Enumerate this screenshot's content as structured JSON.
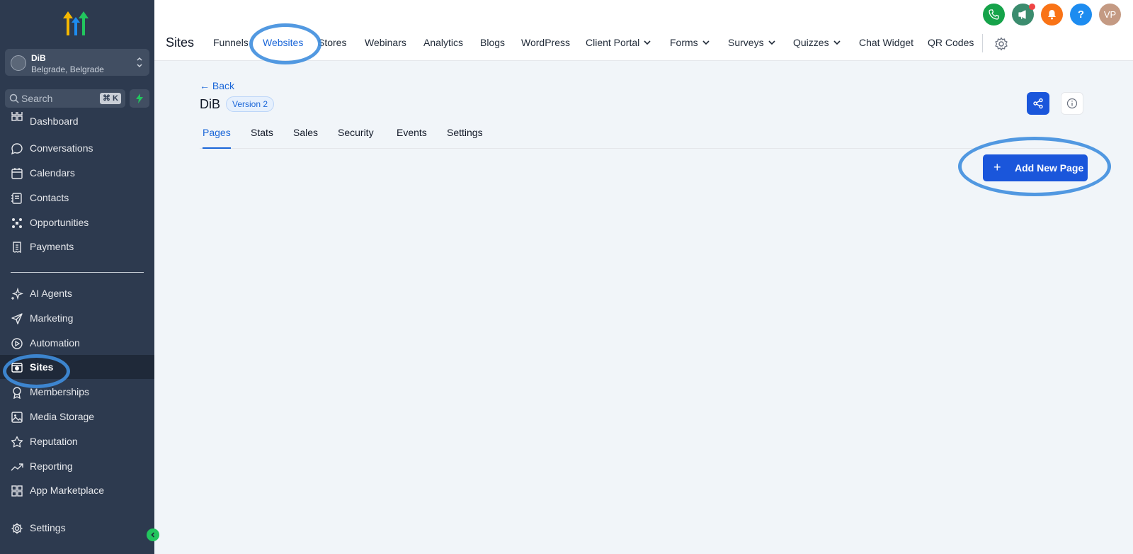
{
  "sidebar": {
    "account": {
      "name": "DiB",
      "location": "Belgrade, Belgrade"
    },
    "search": {
      "placeholder": "Search",
      "shortcut": "⌘ K"
    },
    "items": [
      {
        "label": "Dashboard",
        "icon": "dashboard-icon"
      },
      {
        "label": "Conversations",
        "icon": "chat-bubble-icon"
      },
      {
        "label": "Calendars",
        "icon": "calendar-icon"
      },
      {
        "label": "Contacts",
        "icon": "contacts-icon"
      },
      {
        "label": "Opportunities",
        "icon": "opportunities-icon"
      },
      {
        "label": "Payments",
        "icon": "payments-icon"
      },
      {
        "label": "AI Agents",
        "icon": "sparkle-icon"
      },
      {
        "label": "Marketing",
        "icon": "send-icon"
      },
      {
        "label": "Automation",
        "icon": "automation-icon"
      },
      {
        "label": "Sites",
        "icon": "sites-icon"
      },
      {
        "label": "Memberships",
        "icon": "award-icon"
      },
      {
        "label": "Media Storage",
        "icon": "image-icon"
      },
      {
        "label": "Reputation",
        "icon": "star-icon"
      },
      {
        "label": "Reporting",
        "icon": "trend-icon"
      },
      {
        "label": "App Marketplace",
        "icon": "grid-icon"
      },
      {
        "label": "Settings",
        "icon": "gear-icon"
      }
    ],
    "active_item": "Sites"
  },
  "topbar": {
    "title": "Sites",
    "nav": [
      {
        "label": "Funnels"
      },
      {
        "label": "Websites",
        "active": true
      },
      {
        "label": "Stores"
      },
      {
        "label": "Webinars"
      },
      {
        "label": "Analytics"
      },
      {
        "label": "Blogs"
      },
      {
        "label": "WordPress"
      },
      {
        "label": "Client Portal",
        "dropdown": true
      },
      {
        "label": "Forms",
        "dropdown": true
      },
      {
        "label": "Surveys",
        "dropdown": true
      },
      {
        "label": "Quizzes",
        "dropdown": true
      },
      {
        "label": "Chat Widget"
      },
      {
        "label": "QR Codes"
      }
    ],
    "help_label": "?",
    "user_initials": "VP"
  },
  "main": {
    "back_label": "← Back",
    "site_name": "DiB",
    "version_badge": "Version 2",
    "tabs": [
      {
        "label": "Pages",
        "active": true
      },
      {
        "label": "Stats"
      },
      {
        "label": "Sales"
      },
      {
        "label": "Security"
      },
      {
        "label": "Events"
      },
      {
        "label": "Settings"
      }
    ],
    "add_button": {
      "plus": "+",
      "label": "Add New Page"
    }
  },
  "colors": {
    "sidebar_bg": "#2d3a4f",
    "accent": "#1a56db",
    "active_link": "#1a66d8",
    "highlight": "#3f8ede"
  }
}
